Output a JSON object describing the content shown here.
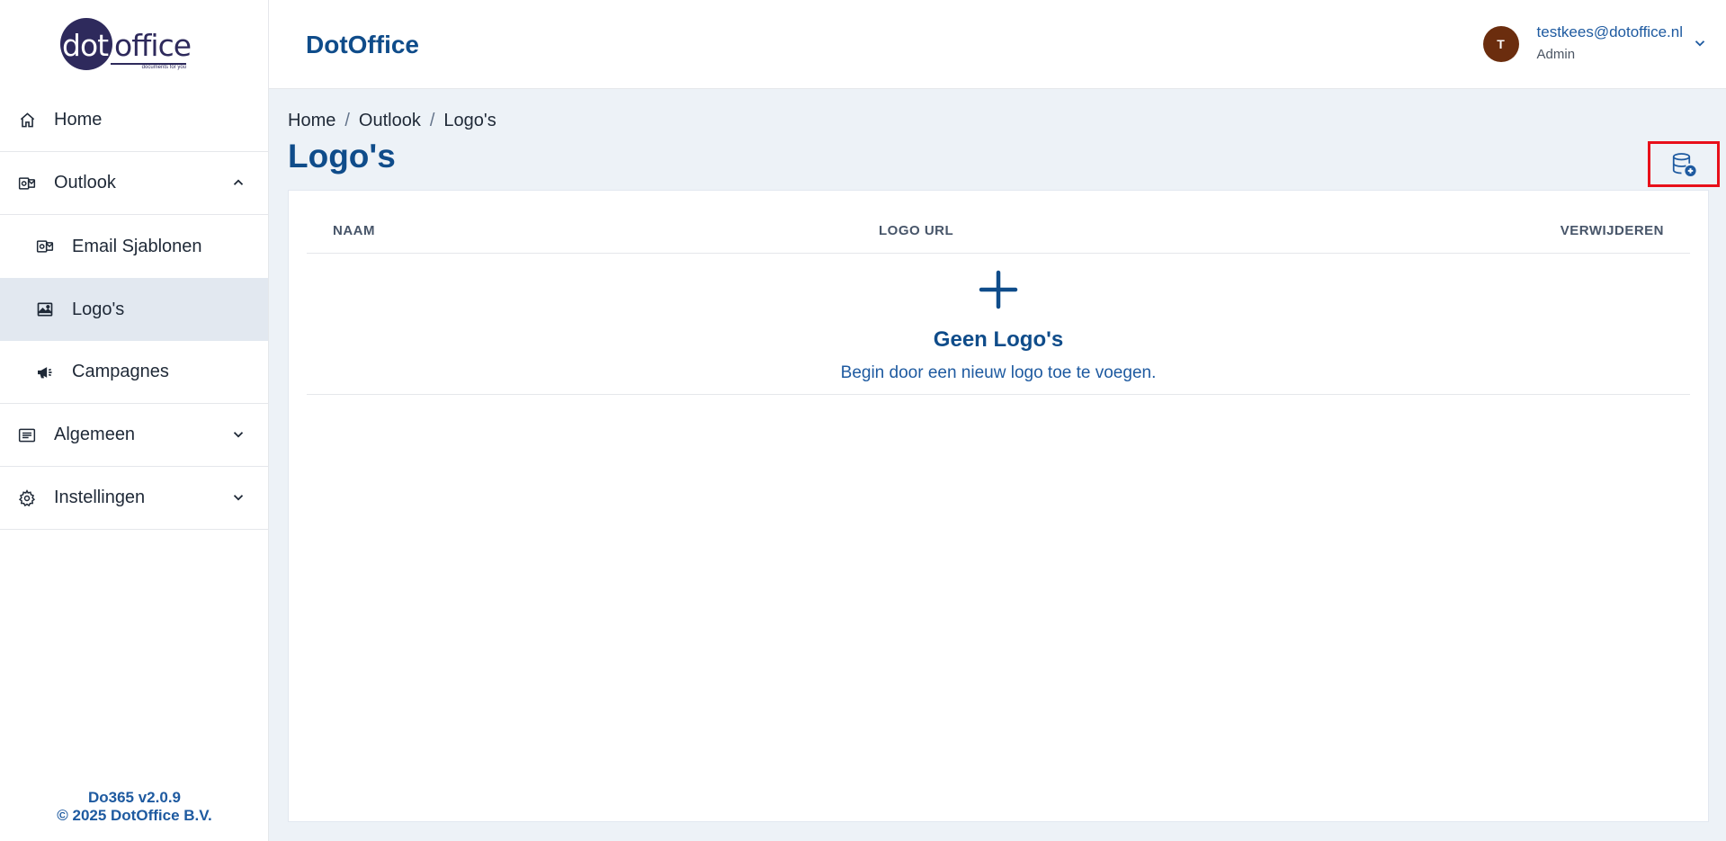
{
  "sidebar": {
    "logo": {
      "part1": "dot",
      "part2": "office",
      "tagline": "documents for you"
    },
    "items": [
      {
        "label": "Home",
        "icon": "home-icon"
      },
      {
        "label": "Outlook",
        "icon": "outlook-icon",
        "expanded": true
      },
      {
        "label": "Email Sjablonen",
        "icon": "outlook-icon"
      },
      {
        "label": "Logo's",
        "icon": "image-icon",
        "active": true
      },
      {
        "label": "Campagnes",
        "icon": "megaphone-icon"
      },
      {
        "label": "Algemeen",
        "icon": "list-icon",
        "expanded": false
      },
      {
        "label": "Instellingen",
        "icon": "gear-icon",
        "expanded": false
      }
    ],
    "footer": {
      "version": "Do365 v2.0.9",
      "copyright": "© 2025 DotOffice B.V."
    }
  },
  "header": {
    "brand": "DotOffice",
    "user": {
      "initial": "T",
      "email": "testkees@dotoffice.nl",
      "role": "Admin"
    }
  },
  "main": {
    "breadcrumb": [
      "Home",
      "Outlook",
      "Logo's"
    ],
    "title": "Logo's",
    "table": {
      "columns": [
        "NAAM",
        "LOGO URL",
        "VERWIJDEREN"
      ],
      "empty_title": "Geen Logo's",
      "empty_subtitle": "Begin door een nieuw logo toe te voegen."
    }
  },
  "colors": {
    "primary": "#0f4c8a",
    "highlight": "#e8101a",
    "avatar": "#6b2d0e",
    "active_bg": "#e2e8f0",
    "content_bg": "#edf2f7"
  }
}
